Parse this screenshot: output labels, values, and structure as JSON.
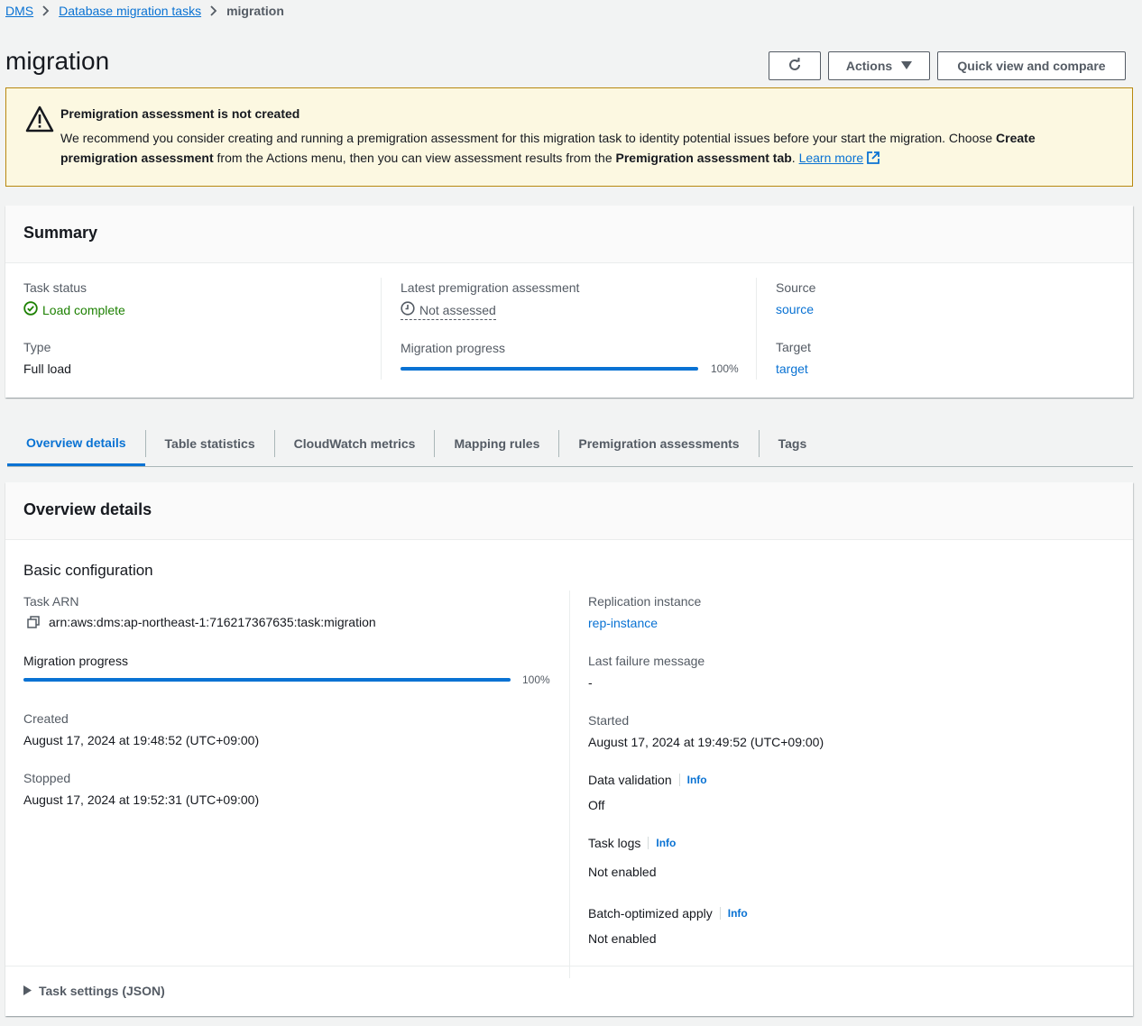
{
  "breadcrumb": {
    "root": "DMS",
    "parent": "Database migration tasks",
    "current": "migration"
  },
  "page": {
    "title": "migration"
  },
  "header_buttons": {
    "refresh_icon": "refresh-icon",
    "actions": "Actions",
    "quick_view": "Quick view and compare"
  },
  "alert": {
    "title": "Premigration assessment is not created",
    "body_part1": "We recommend you consider creating and running a premigration assessment for this migration task to identity potential issues before your start the migration. Choose ",
    "body_bold1": "Create premigration assessment",
    "body_part2": " from the Actions menu, then you can view assessment results from the ",
    "body_bold2": "Premigration assessment tab",
    "body_part3": ". ",
    "learn_more": "Learn more"
  },
  "summary": {
    "heading": "Summary",
    "task_status_label": "Task status",
    "task_status_value": "Load complete",
    "type_label": "Type",
    "type_value": "Full load",
    "assessment_label": "Latest premigration assessment",
    "assessment_value": "Not assessed",
    "progress_label": "Migration progress",
    "progress_value": 100,
    "progress_text": "100%",
    "source_label": "Source",
    "source_value": "source",
    "target_label": "Target",
    "target_value": "target"
  },
  "tabs": [
    "Overview details",
    "Table statistics",
    "CloudWatch metrics",
    "Mapping rules",
    "Premigration assessments",
    "Tags"
  ],
  "overview": {
    "heading": "Overview details",
    "subheading": "Basic configuration",
    "task_arn_label": "Task ARN",
    "task_arn_value": "arn:aws:dms:ap-northeast-1:716217367635:task:migration",
    "progress_label": "Migration progress",
    "progress_value": 100,
    "progress_text": "100%",
    "created_label": "Created",
    "created_value": "August 17, 2024 at 19:48:52 (UTC+09:00)",
    "stopped_label": "Stopped",
    "stopped_value": "August 17, 2024 at 19:52:31 (UTC+09:00)",
    "replication_label": "Replication instance",
    "replication_value": "rep-instance",
    "failure_label": "Last failure message",
    "failure_value": "-",
    "started_label": "Started",
    "started_value": "August 17, 2024 at 19:49:52 (UTC+09:00)",
    "validation_label": "Data validation",
    "validation_value": "Off",
    "task_logs_label": "Task logs",
    "task_logs_value": "Not enabled",
    "batch_label": "Batch-optimized apply",
    "batch_value": "Not enabled",
    "info": "Info",
    "task_settings": "Task settings (JSON)"
  }
}
